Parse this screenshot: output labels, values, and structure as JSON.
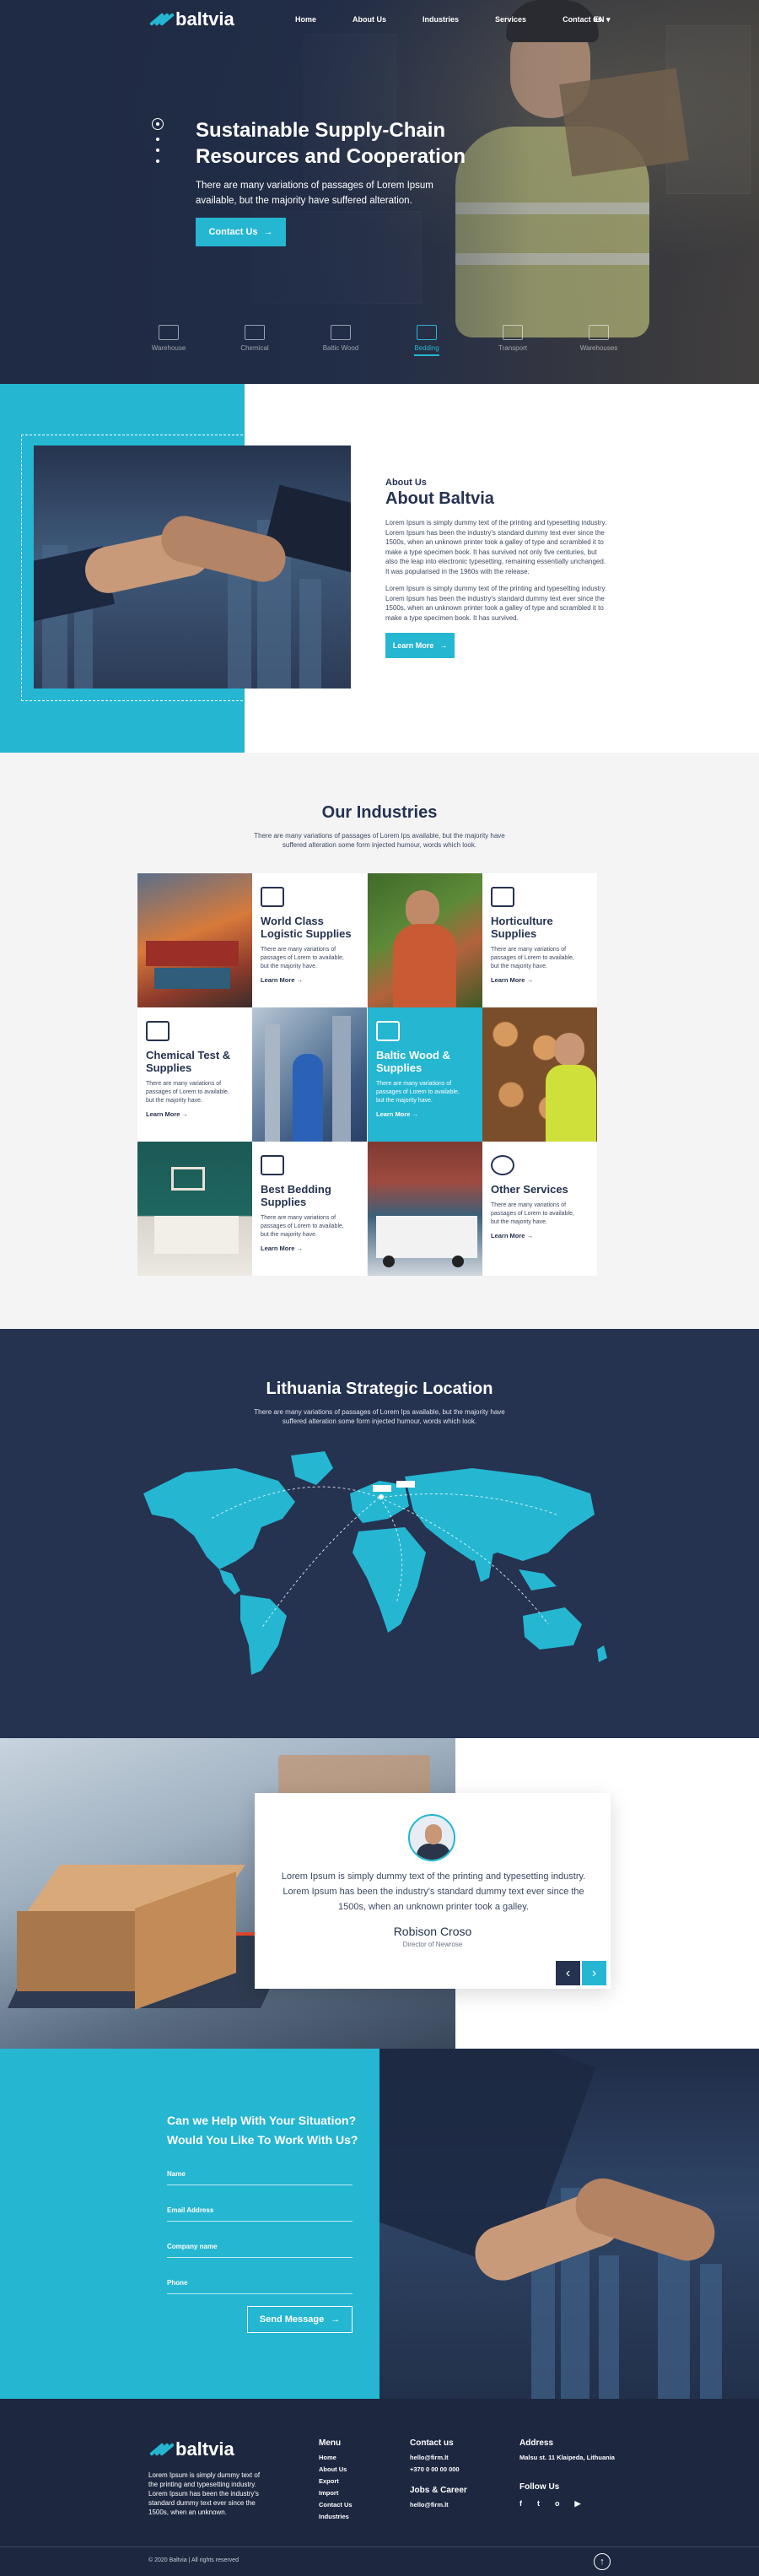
{
  "brand": {
    "name": "baltvia",
    "accent": "#25b6d2",
    "navy": "#253250"
  },
  "nav": {
    "links": [
      "Home",
      "About Us",
      "Industries",
      "Services",
      "Contact us"
    ],
    "lang": "EN ▾"
  },
  "hero": {
    "title": "Sustainable Supply-Chain Resources and Cooperation",
    "subtitle": "There are many variations of passages of Lorem Ipsum available, but the majority have suffered alteration.",
    "button": "Contact Us",
    "categories": [
      "Warehouse",
      "Chemical",
      "Baltic Wood",
      "Bedding",
      "Transport",
      "Warehouses"
    ],
    "active_category": "Bedding"
  },
  "about": {
    "small": "About Us",
    "title": "About Baltvia",
    "p1": "Lorem Ipsum is simply dummy text of the printing and typesetting industry. Lorem Ipsum has been the industry's standard dummy text ever since the 1500s, when an unknown printer took a galley of type and scrambled it to make a type specimen book. It has survived not only five centuries, but also the leap into electronic typesetting, remaining essentially unchanged. It was popularised in the 1960s with the release.",
    "p2": "Lorem Ipsum is simply dummy text of the printing and typesetting industry. Lorem Ipsum has been the industry's standard dummy text ever since the 1500s, when an unknown printer took a galley of type and scrambled it to make a type specimen book. It has survived.",
    "button": "Learn More"
  },
  "industries": {
    "title": "Our Industries",
    "subtitle": "There are many variations of passages of Lorem Ips available, but the majority have suffered alteration some form injected humour, words which look.",
    "cards": [
      {
        "title": "World Class Logistic Supplies",
        "text": "There are many variations of passages of Lorem to available, but the majority have.",
        "link": "Learn More →"
      },
      {
        "title": "Horticulture Supplies",
        "text": "There are many variations of passages of Lorem to available, but the majority have.",
        "link": "Learn More →"
      },
      {
        "title": "Chemical Test & Supplies",
        "text": "There are many variations of passages of Lorem to available, but the majority have.",
        "link": "Learn More →"
      },
      {
        "title": "Baltic Wood & Supplies",
        "text": "There are many variations of passages of Lorem to available, but the majority have.",
        "link": "Learn More →"
      },
      {
        "title": "Best Bedding Supplies",
        "text": "There are many variations of passages of Lorem to available, but the majority have.",
        "link": "Learn More →"
      },
      {
        "title": "Other Services",
        "text": "There are many variations of passages of Lorem to available, but the majority have.",
        "link": "Learn More →"
      }
    ]
  },
  "map": {
    "title": "Lithuania Strategic Location",
    "subtitle": "There are many variations of passages of Lorem Ips available, but the majority have suffered alteration some form injected humour, words which look."
  },
  "testimonial": {
    "quote": "Lorem Ipsum is simply dummy text of the printing and typesetting industry. Lorem Ipsum has been the industry's standard dummy text ever since the 1500s, when an unknown printer took a galley.",
    "name": "Robison Croso",
    "role": "Director of Newrose",
    "prev": "‹",
    "next": "›"
  },
  "contact": {
    "title_line1": "Can we Help With Your Situation?",
    "title_line2": "Would You Like To Work With Us?",
    "fields": [
      "Name",
      "Email Address",
      "Company name",
      "Phone"
    ],
    "button": "Send Message"
  },
  "footer": {
    "about": "Lorem Ipsum is simply dummy text of the printing and typesetting industry. Lorem Ipsum has been the industry's standard dummy text ever since the 1500s, when an unknown.",
    "menu_title": "Menu",
    "menu": [
      "Home",
      "About Us",
      "Export",
      "Import",
      "Contact Us",
      "Industries"
    ],
    "contact_title": "Contact us",
    "email": "hello@firm.lt",
    "phone": "+370 0 00 00 000",
    "jobs_title": "Jobs & Career",
    "jobs_email": "hello@firm.lt",
    "address_title": "Address",
    "address": "Malsu st. 11 Klaipeda, Lithuania",
    "follow_title": "Follow Us",
    "social": [
      "f",
      "t",
      "o",
      "▶"
    ],
    "copyright": "© 2020 Baltvia | All rights reserved",
    "to_top": "↑"
  }
}
